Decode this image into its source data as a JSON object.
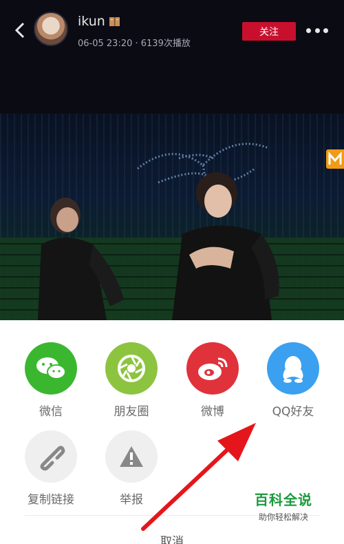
{
  "header": {
    "username": "ikun",
    "meta": "06-05 23:20 · 6139次播放",
    "follow_label": "关注",
    "back_icon": "chevron-left-icon",
    "more_icon": "more-dots-icon"
  },
  "video": {
    "logo_text": "M"
  },
  "share": {
    "items": [
      {
        "label": "微信",
        "icon": "wechat-icon",
        "color": "#3bb72f"
      },
      {
        "label": "朋友圈",
        "icon": "moments-icon",
        "color": "#8cc43f"
      },
      {
        "label": "微博",
        "icon": "weibo-icon",
        "color": "#e0323b"
      },
      {
        "label": "QQ好友",
        "icon": "qq-icon",
        "color": "#3aa0ef"
      },
      {
        "label": "复制链接",
        "icon": "link-icon",
        "color": "#efefef"
      },
      {
        "label": "举报",
        "icon": "warning-icon",
        "color": "#efefef"
      }
    ],
    "cancel_label": "取消"
  },
  "watermark": {
    "title": "百科全说",
    "subtitle": "助你轻松解决"
  },
  "colors": {
    "accent_red": "#c8102e",
    "annotation_arrow": "#e5161b"
  }
}
